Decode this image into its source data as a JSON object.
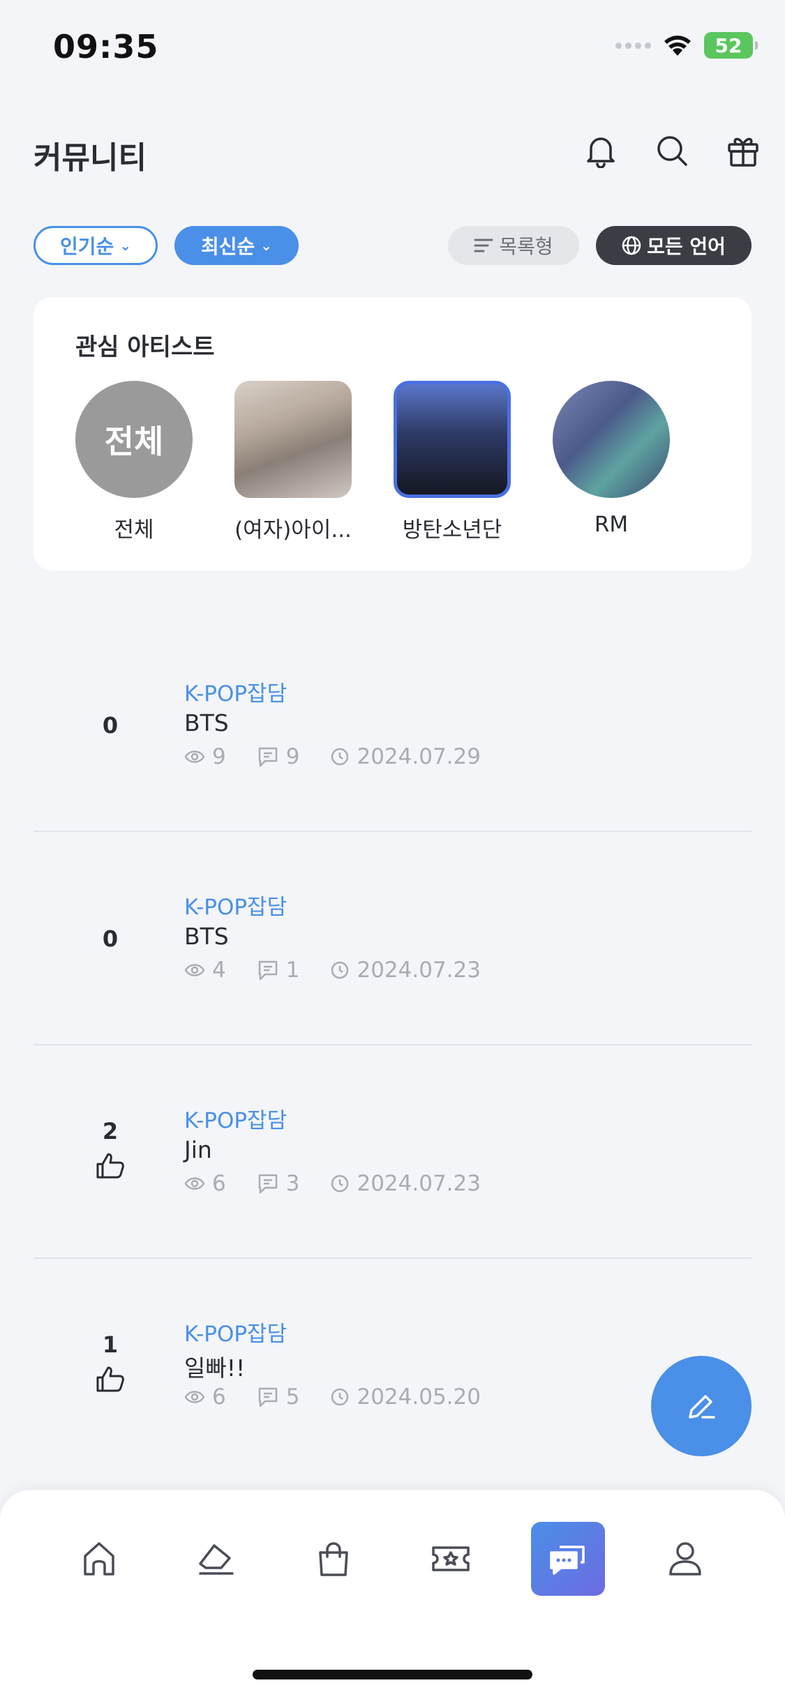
{
  "status_bar": {
    "time": "09:35",
    "battery": "52"
  },
  "header": {
    "title": "커뮤니티"
  },
  "filters": {
    "popular": "인기순",
    "latest": "최신순",
    "view_mode": "목록형",
    "language": "모든 언어"
  },
  "interest": {
    "title": "관심 아티스트",
    "all_badge": "전체",
    "artists": [
      {
        "name": "전체"
      },
      {
        "name": "(여자)아이..."
      },
      {
        "name": "방탄소년단"
      },
      {
        "name": "RM"
      }
    ]
  },
  "posts": [
    {
      "likes": "0",
      "board": "K-POP잡담",
      "title": "BTS",
      "views": "9",
      "comments": "9",
      "date": "2024.07.29"
    },
    {
      "likes": "0",
      "board": "K-POP잡담",
      "title": "BTS",
      "views": "4",
      "comments": "1",
      "date": "2024.07.23"
    },
    {
      "likes": "2",
      "board": "K-POP잡담",
      "title": "Jin",
      "views": "6",
      "comments": "3",
      "date": "2024.07.23"
    },
    {
      "likes": "1",
      "board": "K-POP잡담",
      "title": "일빠!!",
      "views": "6",
      "comments": "5",
      "date": "2024.05.20"
    }
  ],
  "colors": {
    "accent": "#4a8fe8",
    "dark_chip": "#3b3d45",
    "muted": "#a9acb3"
  },
  "icons": {
    "header": [
      "bell-icon",
      "search-icon",
      "gift-icon"
    ],
    "nav": [
      "home-icon",
      "eraser-icon",
      "shopping-bag-icon",
      "ticket-icon",
      "chat-icon",
      "profile-icon"
    ],
    "fab": "pencil-icon"
  }
}
